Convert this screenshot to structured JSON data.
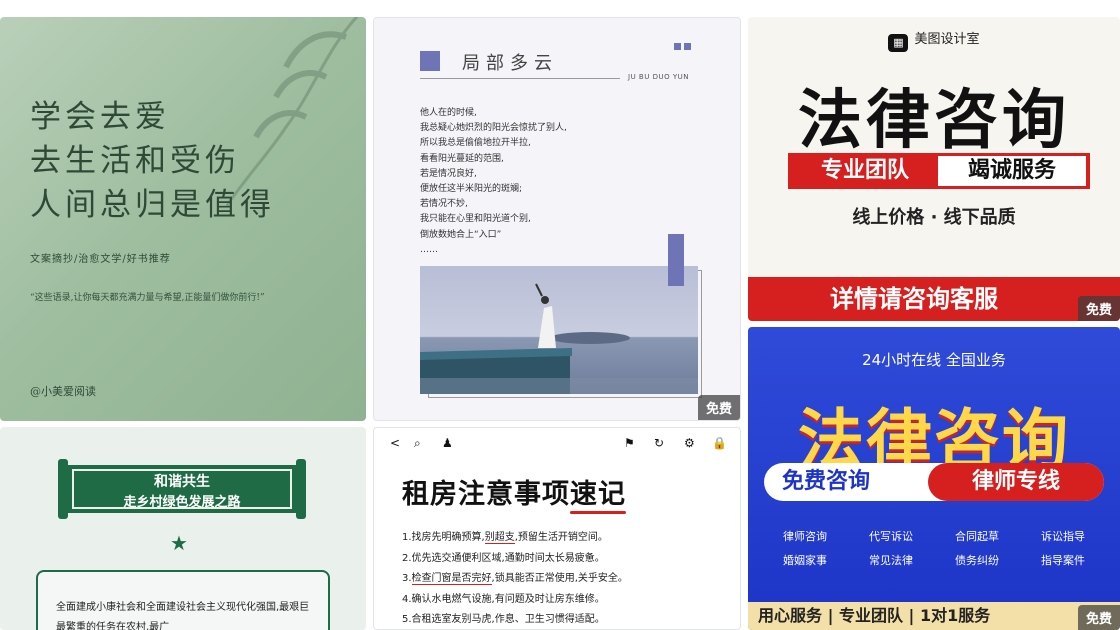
{
  "badge_label": "免费",
  "card_quote": {
    "poem_lines": [
      "学会去爱",
      "去生活和受伤",
      "人间总归是值得"
    ],
    "subtitle": "文案摘抄/治愈文学/好书推荐",
    "quote": "“这些语录,让你每天都充满力量与希望,正能量们做你前行!”",
    "author": "@小美爱阅读"
  },
  "card_cloudy": {
    "title": "局部多云",
    "pinyin": "JU BU DUO YUN",
    "lines": [
      "他人在的时候,",
      "我总疑心她炽烈的阳光会惊扰了别人,",
      "所以我总是偷偷地拉开半拉,",
      "看看阳光蔓延的范围,",
      "若是情况良好,",
      "便放任这半米阳光的斑斓;",
      "若情况不妙,",
      "我只能在心里和阳光道个别,",
      "倒放数她合上“入口”",
      "……"
    ]
  },
  "card_legal_white": {
    "brand": "美图设计室",
    "headline": "法律咨询",
    "tag_left": "专业团队",
    "tag_right": "竭诚服务",
    "slogan": "线上价格 · 线下品质",
    "bottom": "详情请咨询客服"
  },
  "card_legal_blue": {
    "top": "24小时在线 全国业务",
    "headline": "法律咨询",
    "pill_left": "免费咨询",
    "pill_right": "律师专线",
    "services": [
      "律师咨询",
      "代写诉讼",
      "合同起草",
      "诉讼指导",
      "婚姻家事",
      "常见法律",
      "债务纠纷",
      "指导案件"
    ],
    "footer": "用心服务 | 专业团队 | 1对1服务"
  },
  "card_harmony": {
    "title_1": "和谐共生",
    "title_2": "走乡村绿色发展之路",
    "body": "全面建成小康社会和全面建设社会主义现代化强国,最艰巨最繁重的任务在农村,最广"
  },
  "card_rent": {
    "toolbar": [
      "<",
      "⌕",
      "♟",
      "⚑",
      "↻",
      "⚙",
      "🔒"
    ],
    "headline_main": "租房注意事项",
    "headline_hl": "速记",
    "items": [
      {
        "pre": "1.找房先明确预算,",
        "mark": "别超支",
        "post": ",预留生活开销空间。"
      },
      {
        "pre": "2.优先选交通便利区域,通勤时间太长易疲惫。",
        "mark": "",
        "post": ""
      },
      {
        "pre": "3.",
        "mark": "检查门窗是否完好",
        "post": ",锁具能否正常使用,关乎安全。"
      },
      {
        "pre": "4.确认水电燃气设施,有问题及时让房东维修。",
        "mark": "",
        "post": ""
      },
      {
        "pre": "5.合租选室友别马虎,作息、卫生习惯得适配。",
        "mark": "",
        "post": ""
      }
    ]
  }
}
